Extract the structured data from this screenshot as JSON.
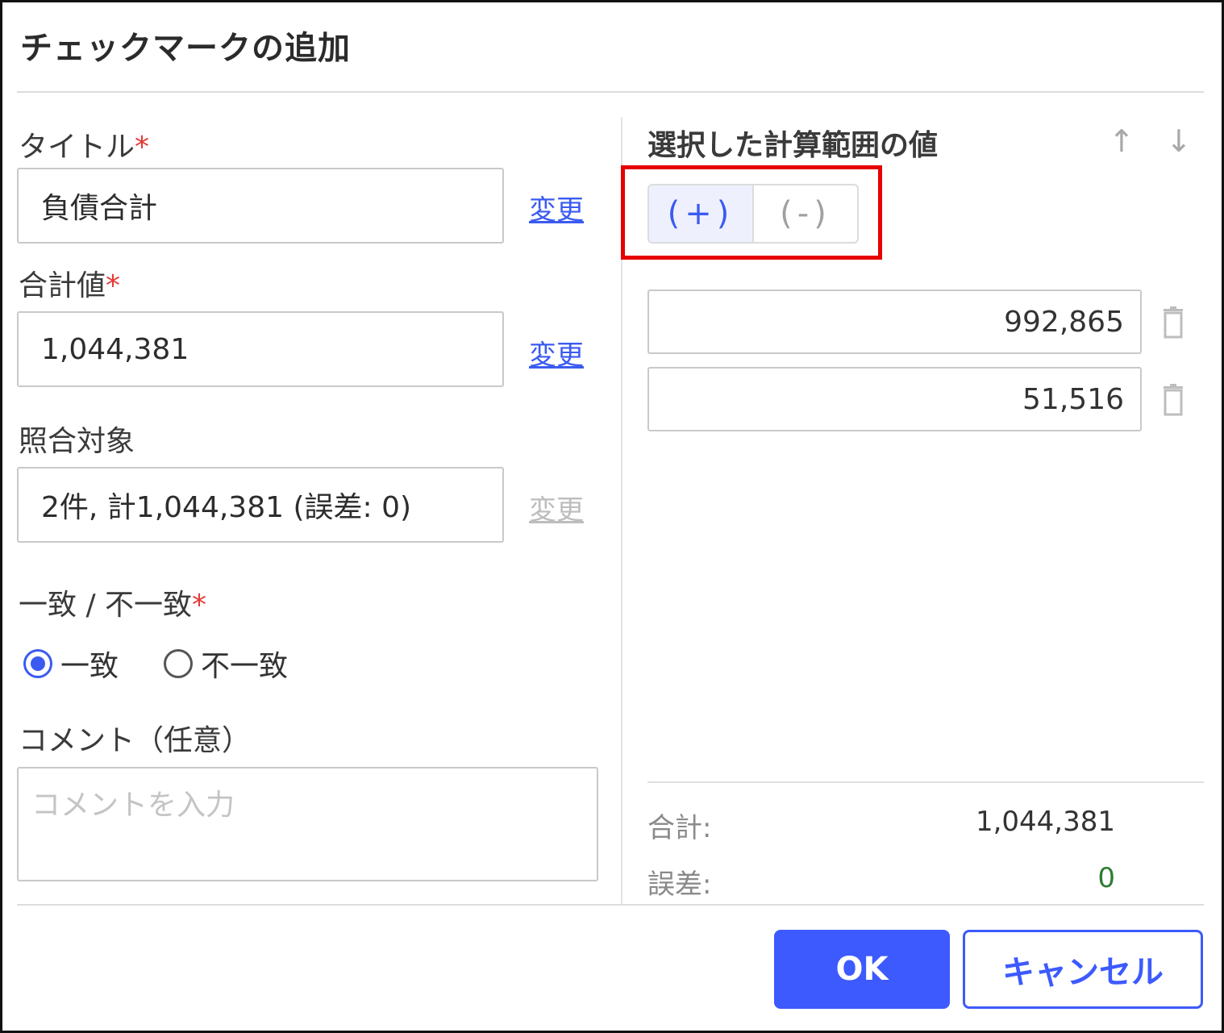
{
  "dialog": {
    "title": "チェックマークの追加",
    "ok_label": "OK",
    "cancel_label": "キャンセル"
  },
  "left": {
    "title_label": "タイトル",
    "title_value": "負債合計",
    "total_label": "合計値",
    "total_value": "1,044,381",
    "match_target_label": "照合対象",
    "match_target_value": "2件, 計1,044,381 (誤差: 0)",
    "change_label": "変更",
    "required_mark": "*",
    "match_label": "一致 / 不一致",
    "radio_match": "一致",
    "radio_mismatch": "不一致",
    "radio_selected": "一致",
    "comment_label": "コメント（任意）",
    "comment_placeholder": "コメントを入力"
  },
  "right": {
    "title": "選択した計算範囲の値",
    "up_icon": "↑",
    "down_icon": "↓",
    "plus_label": "(+)",
    "minus_label": "(-)",
    "active_sign": "plus",
    "values": [
      "992,865",
      "51,516"
    ],
    "sum_label": "合計:",
    "sum_value": "1,044,381",
    "error_label": "誤差:",
    "error_value": "0"
  },
  "colors": {
    "accent": "#3d5afe",
    "required": "#e53935",
    "highlight": "#e60000",
    "success": "#2e7d32"
  }
}
